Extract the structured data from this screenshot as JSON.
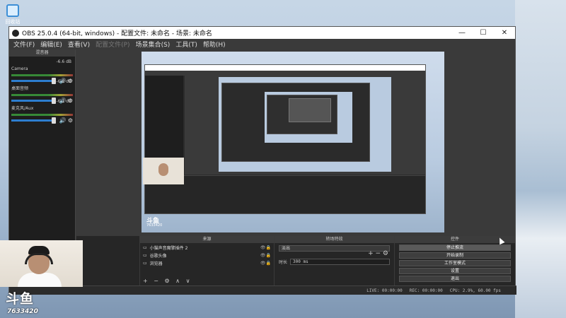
{
  "desktop": {
    "recycle_label": "回收站"
  },
  "window": {
    "title": "OBS 25.0.4 (64-bit, windows) - 配置文件: 未命名 - 场景: 未命名",
    "minimize": "—",
    "maximize": "☐",
    "close": "✕"
  },
  "menu": {
    "items": [
      "文件(F)",
      "编辑(E)",
      "查看(V)",
      "配置文件(P)",
      "场景集合(S)",
      "工具(T)",
      "帮助(H)"
    ]
  },
  "mixer": {
    "header": "混音器",
    "channels": [
      {
        "name": "Camera",
        "db": "-6.6 dB"
      },
      {
        "name": "桌面音频",
        "db": "-6.8 dB"
      },
      {
        "name": "麦克风/Aux",
        "db": "-6.1 dB"
      }
    ]
  },
  "docks": {
    "sources_header": "来源",
    "transitions_header": "转场特效",
    "controls_header": "控件",
    "sources": [
      {
        "name": "小猫声音魔擎插件 2"
      },
      {
        "name": "谷歌头像"
      },
      {
        "name": "浏览器"
      }
    ],
    "source_tools": "+ − ⚙ ∧ ∨",
    "transition_select": "淡出",
    "duration_label": "时长",
    "duration_value": "300 ms",
    "plus_minus": "+ − ⚙",
    "controls": [
      "停止推流",
      "开始录制",
      "工作室模式",
      "设置",
      "退出"
    ]
  },
  "status": {
    "live": "LIVE: 00:00:00",
    "rec": "REC: 00:00:00",
    "cpu": "CPU: 2.9%, 60.00 fps"
  },
  "brand": {
    "logo": "斗鱼",
    "room": "7633420",
    "mini_room": "7633420"
  }
}
